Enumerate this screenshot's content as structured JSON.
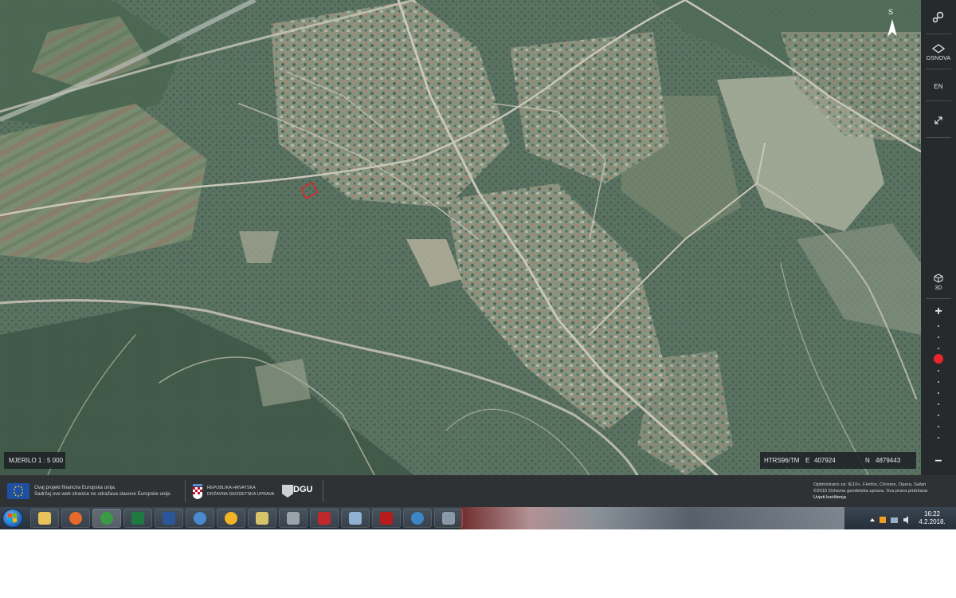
{
  "map": {
    "scale_label": "MJERILO 1 : 5 000",
    "coord_system": "HTRS96/TM",
    "easting_label": "E",
    "easting_value": "407924",
    "northing_label": "N",
    "northing_value": "4879443",
    "compass_label": "S",
    "parcel_highlight_color": "#e02626"
  },
  "sidebar": {
    "search_icon": "search-pin-icon",
    "basemap_label": "OSNOVA",
    "language_label": "EN",
    "fullscreen_icon": "expand-arrows-icon",
    "view3d_label": "3D",
    "zoom_in_label": "+",
    "zoom_out_label": "−",
    "zoom_level_fraction": 0.29,
    "zoom_accent": "#e8262b"
  },
  "footer": {
    "eu_line1": "Ovaj projekt financira Europska unija.",
    "eu_line2": "Sadržaj ove web stranice ne odražava stavove Europske unije.",
    "gov_line1": "REPUBLIKA HRVATSKA",
    "gov_line2": "DRŽAVNA GEODETSKA UPRAVA",
    "dgu_label": "DGU",
    "right_line1": "Optimizirano za: IE10+, Firefox, Chrome, Opera, Safari",
    "right_line2": "©2015 Državna geodetska uprava. Sva prava pridržana",
    "right_line3": "Uvjeti korištenja"
  },
  "taskbar": {
    "apps": [
      "file-explorer-icon",
      "firefox-icon",
      "chrome-icon",
      "excel-icon",
      "word-icon",
      "network-icon",
      "sun-icon",
      "tools-icon",
      "scanner-icon",
      "pdf-printer-icon",
      "calculator-icon",
      "acrobat-icon",
      "globe-icon",
      "paint-icon"
    ],
    "active_app": "chrome-icon",
    "time": "16:22",
    "date": "4.2.2018."
  }
}
